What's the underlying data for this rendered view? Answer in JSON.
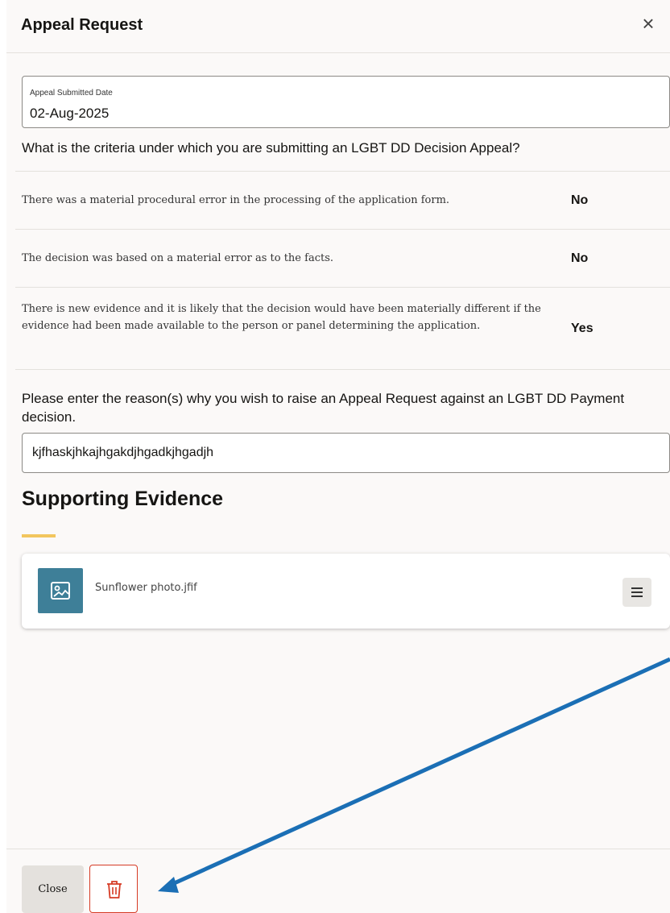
{
  "dialog": {
    "title": "Appeal Request",
    "close_icon": "×"
  },
  "date_field": {
    "label": "Appeal Submitted Date",
    "value": "02-Aug-2025"
  },
  "criteria": {
    "question": "What is the criteria under which you are submitting an LGBT DD Decision Appeal?",
    "rows": [
      {
        "text": "There was a material procedural error in the processing of the application form.",
        "answer": "No"
      },
      {
        "text": "The decision was based on a material error as to the facts.",
        "answer": "No"
      },
      {
        "text": "There is new evidence and it is likely that the decision would have been materially different if the evidence had been made available to the person or panel determining the application.",
        "answer": "Yes"
      }
    ]
  },
  "reason": {
    "question": "Please enter the reason(s) why you wish to raise an Appeal Request against an LGBT DD Payment decision.",
    "value": "kjfhaskjhkajhgakdjhgadkjhgadjh"
  },
  "evidence": {
    "title": "Supporting Evidence",
    "accent_color": "#f2c65e",
    "files": [
      {
        "name": "Sunflower photo.jfif",
        "icon": "image-icon",
        "thumb_color": "#3e7f98"
      }
    ]
  },
  "footer": {
    "close_label": "Close",
    "delete_icon": "trash-icon",
    "delete_color": "#d63b25"
  },
  "annotation": {
    "arrow_color": "#1b6fb5"
  }
}
